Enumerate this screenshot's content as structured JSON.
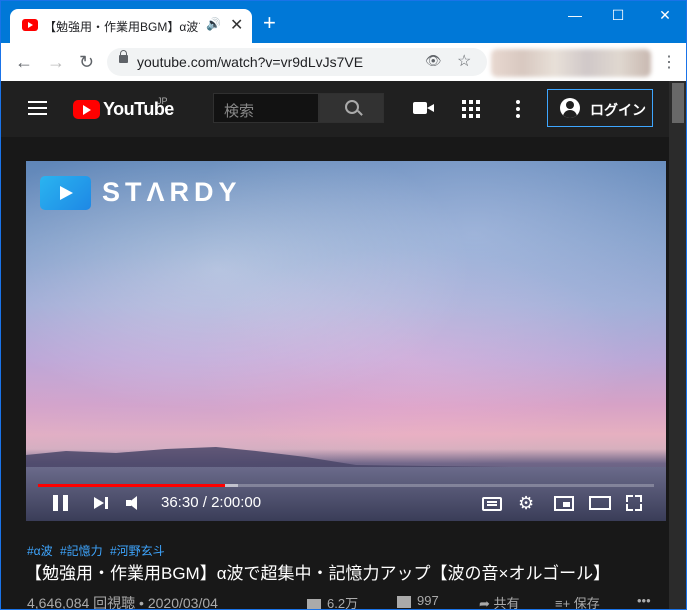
{
  "browser": {
    "tab_title": "【勉強用・作業用BGM】α波で超",
    "new_tab": "+",
    "url": "youtube.com/watch?v=vr9dLvJs7VE",
    "window_minimize": "—",
    "window_maximize": "☐",
    "window_close": "✕"
  },
  "youtube": {
    "logo_text": "YouTube",
    "logo_region": "JP",
    "search_placeholder": "検索",
    "login_label": "ログイン"
  },
  "player": {
    "channel_brand": "STΛRDY",
    "current_time": "36:30",
    "separator": " / ",
    "duration": "2:00:00",
    "progress_played_fraction": 0.304,
    "progress_buffered_fraction": 0.325
  },
  "video": {
    "tags": [
      "#α波",
      "#記憶力",
      "#河野玄斗"
    ],
    "title": "【勉強用・作業用BGM】α波で超集中・記憶力アップ【波の音×オルゴール】",
    "views": "4,646,084 回視聴",
    "date": "2020/03/04",
    "likes": "6.2万",
    "dislikes": "997",
    "share_label": "共有",
    "save_label": "保存"
  },
  "colors": {
    "browser_accent": "#0078d7",
    "youtube_red": "#ff0000",
    "link_blue": "#3ea6ff"
  }
}
